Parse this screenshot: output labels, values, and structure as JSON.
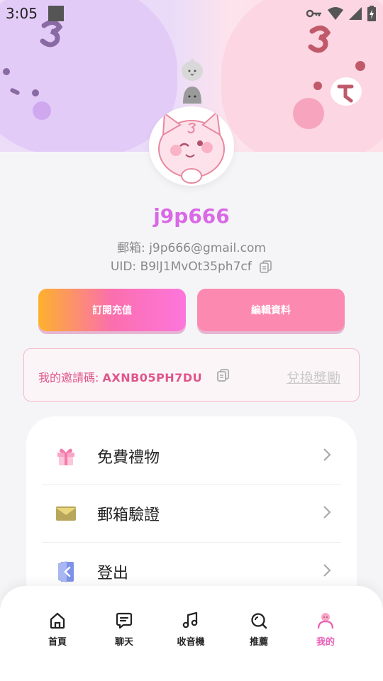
{
  "status_bar": {
    "time": "3:05"
  },
  "profile": {
    "username": "j9p666",
    "email_label": "郵箱:",
    "email": "j9p666@gmail.com",
    "uid_label": "UID:",
    "uid": "B9lJ1MvOt35ph7cf"
  },
  "actions": {
    "subscribe_label": "訂閱充值",
    "edit_label": "編輯資料"
  },
  "invite": {
    "label": "我的邀請碼:",
    "code": "AXNB05PH7DU",
    "redeem_label": "兌換獎勵"
  },
  "menu": [
    {
      "label": "免費禮物",
      "icon": "gift-icon"
    },
    {
      "label": "郵箱驗證",
      "icon": "envelope-icon"
    },
    {
      "label": "登出",
      "icon": "logout-icon"
    }
  ],
  "bottom_nav": [
    {
      "label": "首頁",
      "icon": "home-icon"
    },
    {
      "label": "聊天",
      "icon": "chat-icon"
    },
    {
      "label": "收音機",
      "icon": "music-icon"
    },
    {
      "label": "推薦",
      "icon": "search-icon"
    },
    {
      "label": "我的",
      "icon": "profile-icon",
      "active": true
    }
  ],
  "colors": {
    "accent": "#e960b7",
    "username": "#d969e6",
    "invite_text": "#e0558a"
  }
}
